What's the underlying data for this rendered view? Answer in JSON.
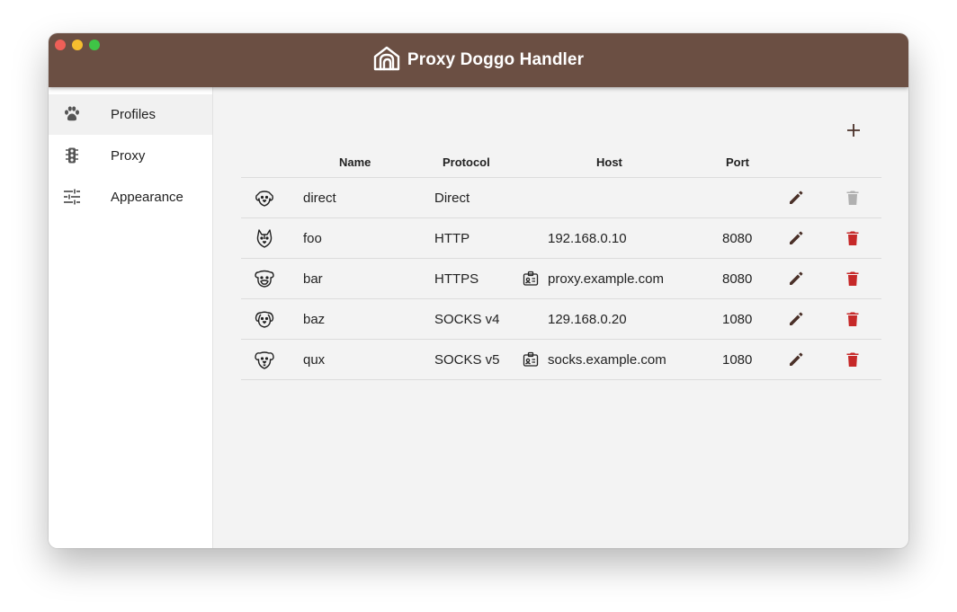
{
  "window": {
    "title": "Proxy Doggo Handler",
    "colors": {
      "titlebar": "#6b4f43",
      "accent": "#6b4f43",
      "delete": "#c62828",
      "disabled": "#b0b0b0"
    }
  },
  "sidebar": {
    "items": [
      {
        "label": "Profiles",
        "icon": "paw-icon",
        "active": true
      },
      {
        "label": "Proxy",
        "icon": "traffic-light-icon",
        "active": false
      },
      {
        "label": "Appearance",
        "icon": "sliders-icon",
        "active": false
      }
    ]
  },
  "toolbar": {
    "add_icon": "plus-icon"
  },
  "table": {
    "headers": {
      "name": "Name",
      "protocol": "Protocol",
      "host": "Host",
      "port": "Port"
    },
    "rows": [
      {
        "icon": "dog-icon",
        "name": "direct",
        "protocol": "Direct",
        "host": "",
        "host_icon": false,
        "port": "",
        "delete_enabled": false
      },
      {
        "icon": "husky-icon",
        "name": "foo",
        "protocol": "HTTP",
        "host": "192.168.0.10",
        "host_icon": false,
        "port": "8080",
        "delete_enabled": true
      },
      {
        "icon": "bulldog-icon",
        "name": "bar",
        "protocol": "HTTPS",
        "host": "proxy.example.com",
        "host_icon": true,
        "port": "8080",
        "delete_enabled": true
      },
      {
        "icon": "hound-icon",
        "name": "baz",
        "protocol": "SOCKS v4",
        "host": "129.168.0.20",
        "host_icon": false,
        "port": "1080",
        "delete_enabled": true
      },
      {
        "icon": "puppy-icon",
        "name": "qux",
        "protocol": "SOCKS v5",
        "host": "socks.example.com",
        "host_icon": true,
        "port": "1080",
        "delete_enabled": true
      }
    ]
  }
}
